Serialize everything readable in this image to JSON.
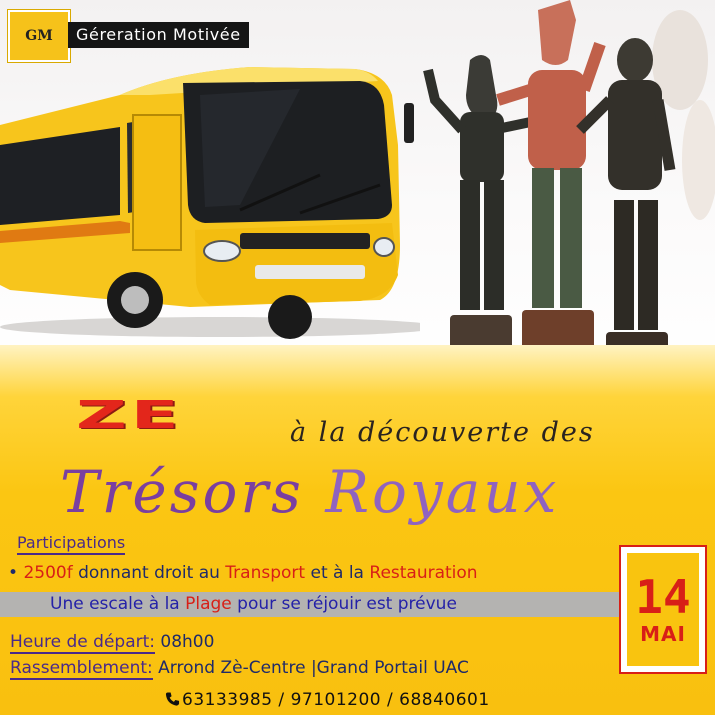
{
  "header": {
    "logo_text": "GM",
    "brand": "Géreration Motivée"
  },
  "title": {
    "ze": "ZE",
    "line1": "à la découverte des",
    "word1": "Trésors",
    "word2": "Royaux"
  },
  "details": {
    "participations_label": "Participations",
    "bullet": "•",
    "price": "2500f",
    "price_text_a": " donnant droit au ",
    "transport": "Transport",
    "price_text_b": " et à la ",
    "restauration": "Restauration",
    "band_text_a": "Une escale à la ",
    "plage": "Plage",
    "band_text_b": " pour se réjouir est prévue",
    "depart_label": "Heure de départ:",
    "depart_value": " 08h00",
    "rassemblement_label": "Rassemblement:",
    "rassemblement_value": " Arrond Zè-Centre  |Grand Portail UAC",
    "phones": "63133985 / 97101200 / 68840601"
  },
  "date": {
    "day": "14",
    "month": "MAI"
  },
  "images": {
    "bus": "yellow-bus",
    "statues": "royal-statues",
    "phone_icon": "phone-icon"
  },
  "colors": {
    "accent_red": "#d81f17",
    "title_purple": "#7a3fa0",
    "yellow_bg": "#f9c00f",
    "band_gray": "#b4b3b1",
    "text_navy": "#1f2a6a"
  }
}
